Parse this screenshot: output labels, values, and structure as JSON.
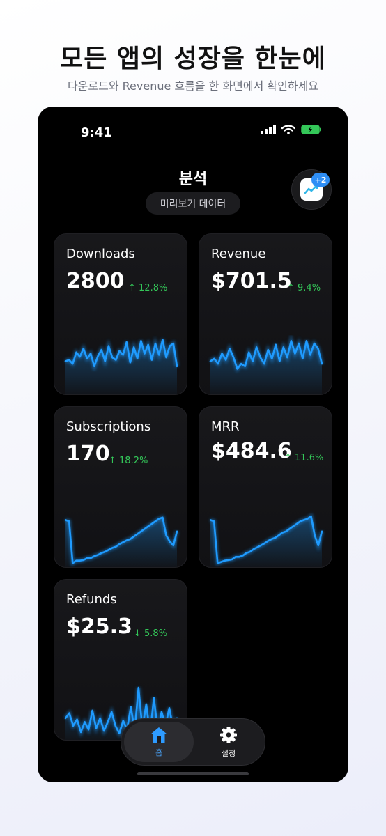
{
  "marketing": {
    "headline": "모든 앱의 성장을 한눈에",
    "subline": "다운로드와 Revenue 흐름을 한 화면에서 확인하세요"
  },
  "status_bar": {
    "time": "9:41",
    "icons": [
      "signal-icon",
      "wifi-icon",
      "battery-charging-icon"
    ]
  },
  "screen": {
    "title": "분석",
    "preview_label": "미리보기 데이터",
    "corner_button": {
      "icon": "chart-icon",
      "badge": "+2"
    }
  },
  "cards": [
    {
      "title": "Downloads",
      "value": "2800",
      "delta": "↑ 12.8%",
      "direction": "up",
      "series": [
        62,
        60,
        66,
        48,
        55,
        42,
        58,
        50,
        70,
        54,
        44,
        62,
        38,
        56,
        60,
        46,
        52,
        32,
        64,
        40,
        58,
        30,
        50,
        36,
        60,
        34,
        52,
        28,
        56,
        38,
        34,
        70
      ]
    },
    {
      "title": "Revenue",
      "value": "$701.5",
      "delta": "↑ 9.4%",
      "direction": "up",
      "series": [
        62,
        58,
        66,
        50,
        60,
        42,
        56,
        74,
        66,
        70,
        48,
        62,
        40,
        56,
        66,
        44,
        58,
        36,
        62,
        40,
        56,
        30,
        50,
        34,
        58,
        30,
        52,
        34,
        42,
        66
      ]
    },
    {
      "title": "Subscriptions",
      "value": "170",
      "delta": "↑ 18.2%",
      "direction": "up",
      "series": [
        40,
        42,
        108,
        104,
        104,
        103,
        100,
        100,
        97,
        95,
        92,
        90,
        87,
        84,
        82,
        78,
        75,
        72,
        70,
        66,
        62,
        58,
        54,
        50,
        46,
        42,
        38,
        36,
        64,
        74,
        80,
        58
      ]
    },
    {
      "title": "MRR",
      "value": "$484.6",
      "delta": "↑ 11.6%",
      "direction": "up",
      "series": [
        40,
        42,
        108,
        106,
        104,
        103,
        102,
        98,
        98,
        96,
        92,
        90,
        86,
        83,
        80,
        77,
        73,
        70,
        68,
        64,
        60,
        58,
        54,
        50,
        46,
        42,
        40,
        38,
        34,
        64,
        80,
        58
      ]
    },
    {
      "title": "Refunds",
      "value": "$25.3",
      "delta": "↓ 5.8%",
      "direction": "down",
      "series": [
        80,
        72,
        92,
        82,
        102,
        86,
        98,
        68,
        96,
        80,
        100,
        86,
        70,
        92,
        104,
        84,
        98,
        62,
        100,
        32,
        96,
        58,
        104,
        48,
        100,
        70,
        92,
        64,
        96,
        80
      ]
    }
  ],
  "tabbar": {
    "home": {
      "label": "홈",
      "icon": "home-icon"
    },
    "settings": {
      "label": "설정",
      "icon": "gear-icon"
    }
  },
  "colors": {
    "accent": "#2e8ef5",
    "line": "#1f9bff",
    "positive": "#34c759"
  }
}
